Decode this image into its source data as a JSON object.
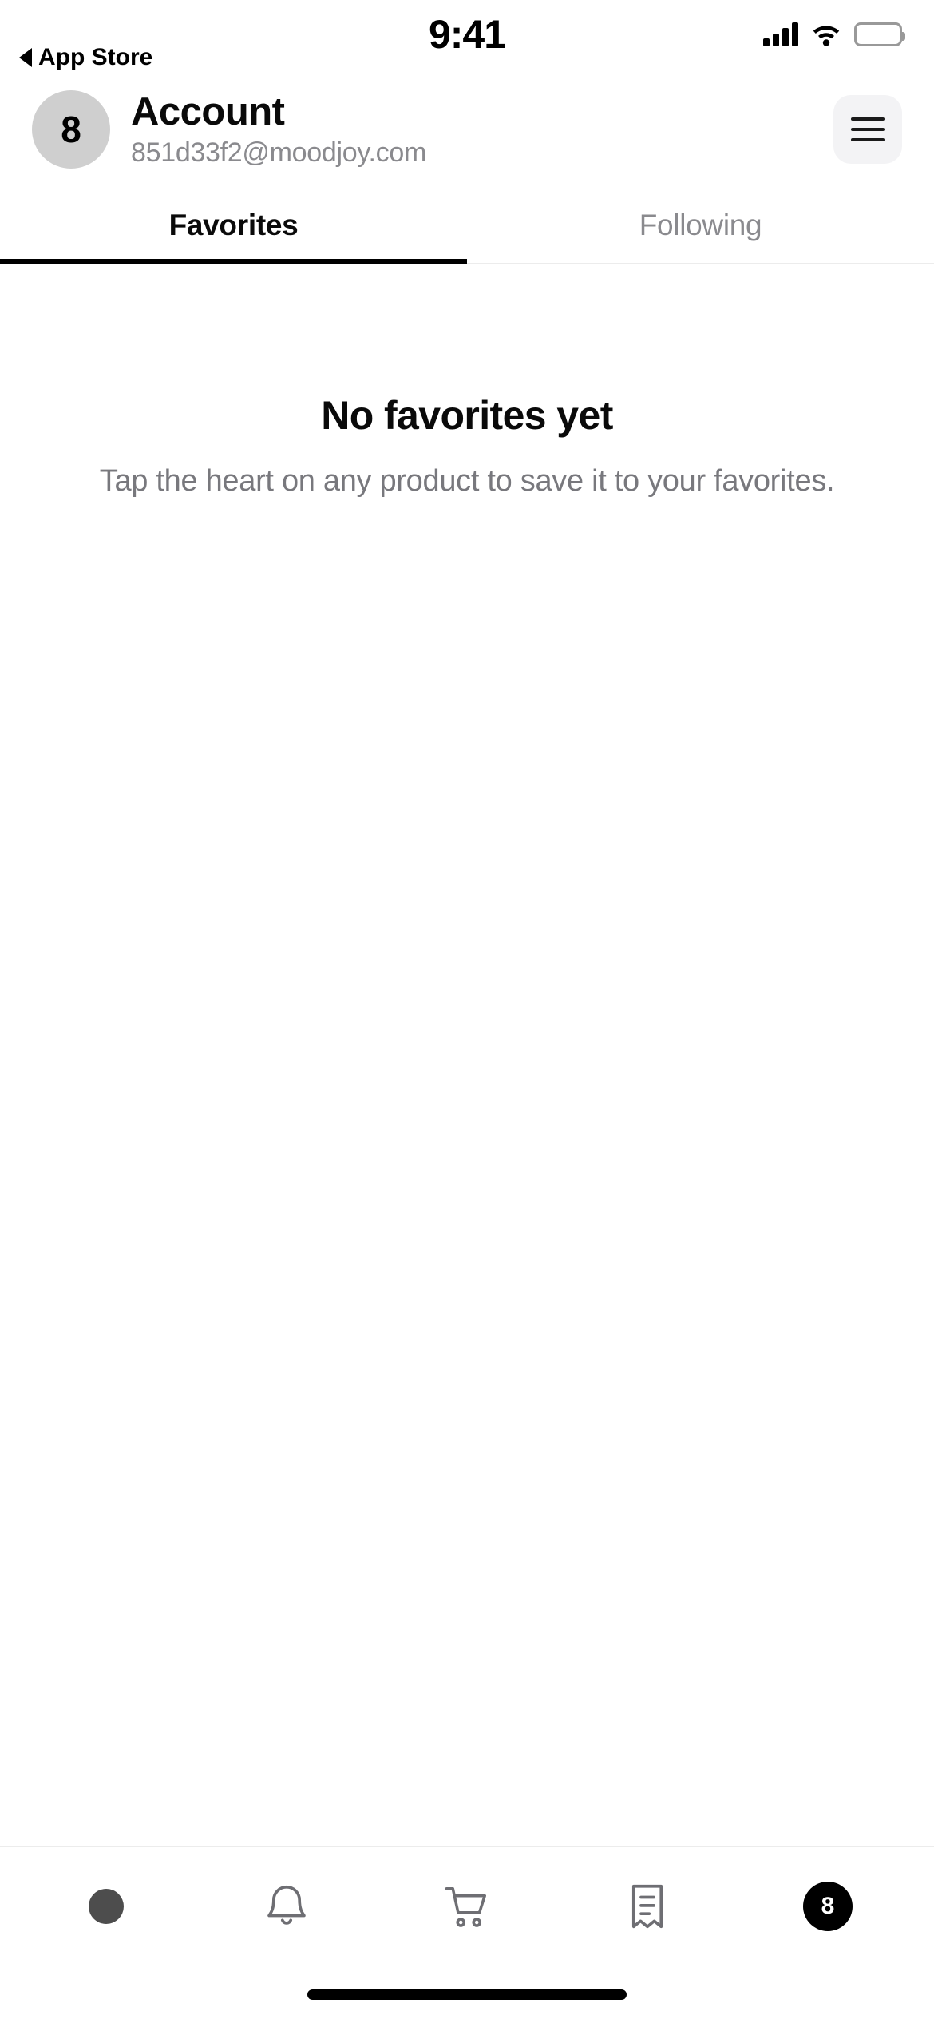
{
  "status_bar": {
    "time": "9:41",
    "back_label": "App Store",
    "back_icon": "triangle-left-icon",
    "signal_icon": "cellular-signal-icon",
    "wifi_icon": "wifi-icon",
    "battery_icon": "battery-full-icon"
  },
  "header": {
    "avatar_initial": "8",
    "title": "Account",
    "email": "851d33f2@moodjoy.com",
    "menu_icon": "hamburger-menu-icon"
  },
  "tabs": [
    {
      "label": "Favorites",
      "active": true
    },
    {
      "label": "Following",
      "active": false
    }
  ],
  "empty_state": {
    "title": "No favorites yet",
    "subtitle": "Tap the heart on any product to save it to your favorites."
  },
  "tabbar": [
    {
      "name": "home",
      "icon": "filled-circle-icon",
      "active": false,
      "label": ""
    },
    {
      "name": "notifications",
      "icon": "bell-icon",
      "active": false,
      "label": ""
    },
    {
      "name": "cart",
      "icon": "shopping-cart-icon",
      "active": false,
      "label": ""
    },
    {
      "name": "orders",
      "icon": "receipt-icon",
      "active": false,
      "label": ""
    },
    {
      "name": "account",
      "icon": "avatar-badge-icon",
      "active": true,
      "label": "8"
    }
  ],
  "colors": {
    "accent": "#000000",
    "text_primary": "#0a0a0a",
    "text_secondary": "#8a8a8e",
    "avatar_bg": "#cfcfcf",
    "menu_bg": "#f3f3f5",
    "divider": "#ececec",
    "icon_inactive": "#6e6e73"
  }
}
